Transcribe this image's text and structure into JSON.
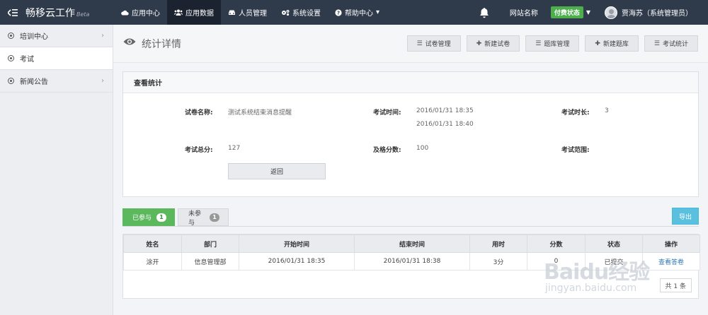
{
  "topbar": {
    "brand": "畅移云工作",
    "beta": "Beta",
    "nav": [
      {
        "label": "应用中心",
        "icon": "cloud-icon"
      },
      {
        "label": "应用数据",
        "icon": "users-icon"
      },
      {
        "label": "人员管理",
        "icon": "car-icon"
      },
      {
        "label": "系统设置",
        "icon": "gears-icon"
      },
      {
        "label": "帮助中心",
        "icon": "help-icon"
      }
    ],
    "site_name": "网站名称",
    "status_label": "付费状态",
    "user_name": "贾海苏（系统管理员）"
  },
  "sidebar": {
    "items": [
      {
        "label": "培训中心"
      },
      {
        "label": "考试"
      },
      {
        "label": "新闻公告"
      }
    ]
  },
  "page": {
    "title": "统计详情",
    "toolbar": [
      "试卷管理",
      "新建试卷",
      "题库管理",
      "新建题库",
      "考试统计"
    ]
  },
  "stats": {
    "header": "查看统计",
    "paper_name_label": "试卷名称:",
    "paper_name": "测试系统结束消息提醒",
    "exam_time_label": "考试时间:",
    "exam_start": "2016/01/31 18:35",
    "exam_end": "2016/01/31 18:40",
    "duration_label": "考试时长:",
    "duration": "3",
    "total_label": "考试总分:",
    "total": "127",
    "pass_label": "及格分数:",
    "pass": "100",
    "scope_label": "考试范围:",
    "back_label": "返回"
  },
  "tabs": {
    "participated": {
      "label": "已参与",
      "count": "1"
    },
    "not_participated": {
      "label": "未参与",
      "count": "1"
    },
    "export_label": "导出"
  },
  "table": {
    "headers": [
      "姓名",
      "部门",
      "开始时间",
      "结束时间",
      "用时",
      "分数",
      "状态",
      "操作"
    ],
    "rows": [
      [
        "涂开",
        "信息管理部",
        "2016/01/31 18:35",
        "2016/01/31 18:38",
        "3分",
        "0",
        "已提交",
        "查看答卷"
      ]
    ],
    "pager": "共 1 条"
  },
  "watermark": {
    "brand": "Baidu经验",
    "url": "jingyan.baidu.com"
  },
  "colors": {
    "topbar": "#2f3a4b",
    "success": "#5cb85c",
    "info": "#5bc0de",
    "paid": "#4cae4c"
  }
}
